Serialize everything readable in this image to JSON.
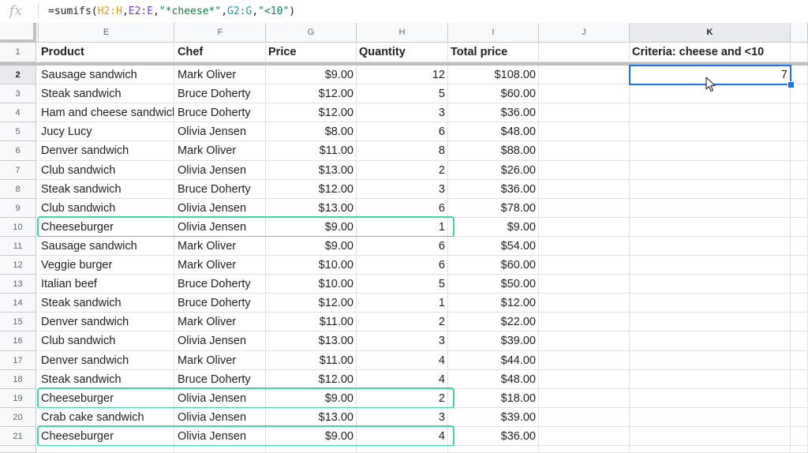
{
  "formula_bar": {
    "fx_label": "fx",
    "tokens": [
      {
        "text": "=sumifs(",
        "color": "#202124"
      },
      {
        "text": "H2:H",
        "color": "#e69b00"
      },
      {
        "text": ",",
        "color": "#202124"
      },
      {
        "text": "E2:E",
        "color": "#6f42c1"
      },
      {
        "text": ",",
        "color": "#202124"
      },
      {
        "text": "\"*cheese*\"",
        "color": "#0b8043"
      },
      {
        "text": ",",
        "color": "#202124"
      },
      {
        "text": "G2:G",
        "color": "#1a9ba3"
      },
      {
        "text": ",",
        "color": "#202124"
      },
      {
        "text": "\"<10\"",
        "color": "#0b8043"
      },
      {
        "text": ")",
        "color": "#202124"
      }
    ]
  },
  "columns": [
    "E",
    "F",
    "G",
    "H",
    "I",
    "J",
    "K"
  ],
  "selected_column": "K",
  "selected_row": 2,
  "header_row": {
    "product": "Product",
    "chef": "Chef",
    "price": "Price",
    "quantity": "Quantity",
    "total": "Total price",
    "j": "",
    "criteria": "Criteria: cheese and <10"
  },
  "result_value": "7",
  "rows": [
    {
      "n": 2,
      "product": "Sausage sandwich",
      "chef": "Mark Oliver",
      "price": "$9.00",
      "qty": "12",
      "total": "$108.00",
      "highlight": false
    },
    {
      "n": 3,
      "product": "Steak sandwich",
      "chef": "Bruce Doherty",
      "price": "$12.00",
      "qty": "5",
      "total": "$60.00",
      "highlight": false
    },
    {
      "n": 4,
      "product": "Ham and cheese sandwich",
      "chef": "Bruce Doherty",
      "price": "$12.00",
      "qty": "3",
      "total": "$36.00",
      "highlight": false
    },
    {
      "n": 5,
      "product": "Jucy Lucy",
      "chef": "Olivia Jensen",
      "price": "$8.00",
      "qty": "6",
      "total": "$48.00",
      "highlight": false
    },
    {
      "n": 6,
      "product": "Denver sandwich",
      "chef": "Mark Oliver",
      "price": "$11.00",
      "qty": "8",
      "total": "$88.00",
      "highlight": false
    },
    {
      "n": 7,
      "product": "Club sandwich",
      "chef": "Olivia Jensen",
      "price": "$13.00",
      "qty": "2",
      "total": "$26.00",
      "highlight": false
    },
    {
      "n": 8,
      "product": "Steak sandwich",
      "chef": "Bruce Doherty",
      "price": "$12.00",
      "qty": "3",
      "total": "$36.00",
      "highlight": false
    },
    {
      "n": 9,
      "product": "Club sandwich",
      "chef": "Olivia Jensen",
      "price": "$13.00",
      "qty": "6",
      "total": "$78.00",
      "highlight": false
    },
    {
      "n": 10,
      "product": "Cheeseburger",
      "chef": "Olivia Jensen",
      "price": "$9.00",
      "qty": "1",
      "total": "$9.00",
      "highlight": true
    },
    {
      "n": 11,
      "product": "Sausage sandwich",
      "chef": "Mark Oliver",
      "price": "$9.00",
      "qty": "6",
      "total": "$54.00",
      "highlight": false
    },
    {
      "n": 12,
      "product": "Veggie burger",
      "chef": "Mark Oliver",
      "price": "$10.00",
      "qty": "6",
      "total": "$60.00",
      "highlight": false
    },
    {
      "n": 13,
      "product": "Italian beef",
      "chef": "Bruce Doherty",
      "price": "$10.00",
      "qty": "5",
      "total": "$50.00",
      "highlight": false
    },
    {
      "n": 14,
      "product": "Steak sandwich",
      "chef": "Bruce Doherty",
      "price": "$12.00",
      "qty": "1",
      "total": "$12.00",
      "highlight": false
    },
    {
      "n": 15,
      "product": "Denver sandwich",
      "chef": "Mark Oliver",
      "price": "$11.00",
      "qty": "2",
      "total": "$22.00",
      "highlight": false
    },
    {
      "n": 16,
      "product": "Club sandwich",
      "chef": "Olivia Jensen",
      "price": "$13.00",
      "qty": "3",
      "total": "$39.00",
      "highlight": false
    },
    {
      "n": 17,
      "product": "Denver sandwich",
      "chef": "Mark Oliver",
      "price": "$11.00",
      "qty": "4",
      "total": "$44.00",
      "highlight": false
    },
    {
      "n": 18,
      "product": "Steak sandwich",
      "chef": "Bruce Doherty",
      "price": "$12.00",
      "qty": "4",
      "total": "$48.00",
      "highlight": false
    },
    {
      "n": 19,
      "product": "Cheeseburger",
      "chef": "Olivia Jensen",
      "price": "$9.00",
      "qty": "2",
      "total": "$18.00",
      "highlight": true
    },
    {
      "n": 20,
      "product": "Crab cake sandwich",
      "chef": "Olivia Jensen",
      "price": "$13.00",
      "qty": "3",
      "total": "$39.00",
      "highlight": false
    },
    {
      "n": 21,
      "product": "Cheeseburger",
      "chef": "Olivia Jensen",
      "price": "$9.00",
      "qty": "4",
      "total": "$36.00",
      "highlight": true
    }
  ],
  "colors": {
    "highlight_border": "#3ed6a3",
    "selection": "#1a73e8"
  }
}
